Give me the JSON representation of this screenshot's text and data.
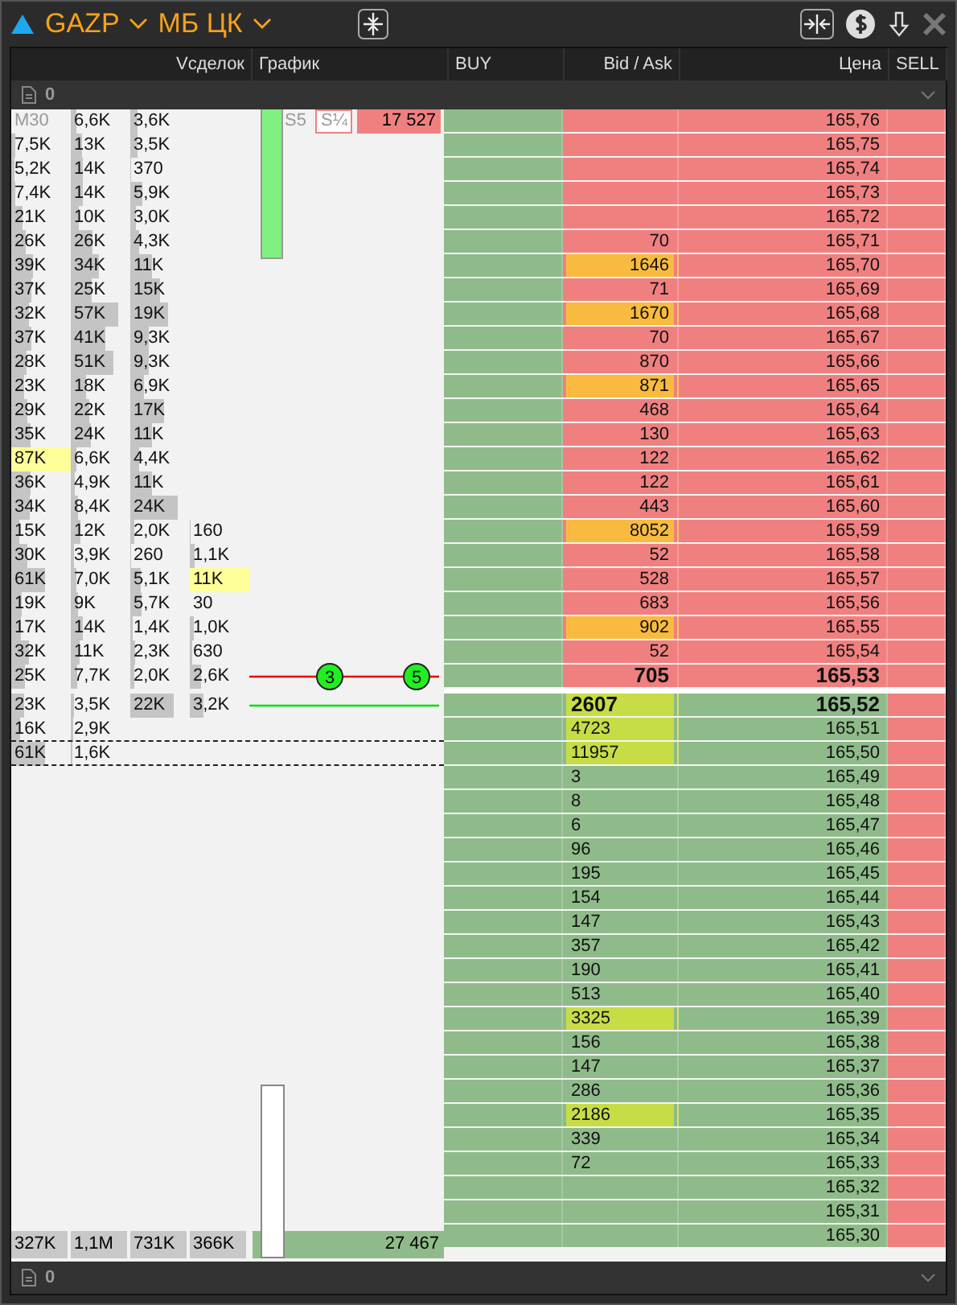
{
  "title": {
    "symbol": "GAZP",
    "board": "МБ ЦК"
  },
  "columns": {
    "volume": "Vсделок",
    "chart": "График",
    "buy": "BUY",
    "bid_ask": "Bid / Ask",
    "price": "Цена",
    "sell": "SELL"
  },
  "orders_bar": {
    "count": "0"
  },
  "left_rows": [
    {
      "cells": [
        {
          "kind": "label",
          "text": "M30"
        },
        {
          "kind": "volume",
          "text": "6,6K",
          "highlight": false
        },
        {
          "kind": "volume",
          "text": "3,6K",
          "highlight": false
        }
      ],
      "chart": {
        "kind": "labels",
        "tag": "S5",
        "scale": "S¼",
        "value": "17 527"
      }
    },
    {
      "cells": [
        {
          "kind": "volume",
          "text": "7,5K",
          "highlight": false
        },
        {
          "kind": "volume",
          "text": "13K",
          "highlight": false
        },
        {
          "kind": "volume",
          "text": "3,5K",
          "highlight": false
        }
      ]
    },
    {
      "cells": [
        {
          "kind": "volume",
          "text": "5,2K",
          "highlight": false
        },
        {
          "kind": "volume",
          "text": "14K",
          "highlight": false
        },
        {
          "kind": "volume",
          "text": "370",
          "highlight": false
        }
      ]
    },
    {
      "cells": [
        {
          "kind": "volume",
          "text": "7,4K",
          "highlight": false
        },
        {
          "kind": "volume",
          "text": "14K",
          "highlight": false
        },
        {
          "kind": "volume",
          "text": "5,9K",
          "highlight": false
        }
      ]
    },
    {
      "cells": [
        {
          "kind": "volume",
          "text": "21K",
          "highlight": false
        },
        {
          "kind": "volume",
          "text": "10K",
          "highlight": false
        },
        {
          "kind": "volume",
          "text": "3,0K",
          "highlight": false
        }
      ]
    },
    {
      "cells": [
        {
          "kind": "volume",
          "text": "26K",
          "highlight": false
        },
        {
          "kind": "volume",
          "text": "26K",
          "highlight": false
        },
        {
          "kind": "volume",
          "text": "4,3K",
          "highlight": false
        }
      ]
    },
    {
      "cells": [
        {
          "kind": "volume",
          "text": "39K",
          "highlight": false
        },
        {
          "kind": "volume",
          "text": "34K",
          "highlight": false
        },
        {
          "kind": "volume",
          "text": "11K",
          "highlight": false
        }
      ]
    },
    {
      "cells": [
        {
          "kind": "volume",
          "text": "37K",
          "highlight": false
        },
        {
          "kind": "volume",
          "text": "25K",
          "highlight": false
        },
        {
          "kind": "volume",
          "text": "15K",
          "highlight": false
        }
      ]
    },
    {
      "cells": [
        {
          "kind": "volume",
          "text": "32K",
          "highlight": false
        },
        {
          "kind": "volume",
          "text": "57K",
          "highlight": false
        },
        {
          "kind": "volume",
          "text": "19K",
          "highlight": false
        }
      ]
    },
    {
      "cells": [
        {
          "kind": "volume",
          "text": "37K",
          "highlight": false
        },
        {
          "kind": "volume",
          "text": "41K",
          "highlight": false
        },
        {
          "kind": "volume",
          "text": "9,3K",
          "highlight": false
        }
      ]
    },
    {
      "cells": [
        {
          "kind": "volume",
          "text": "28K",
          "highlight": false
        },
        {
          "kind": "volume",
          "text": "51K",
          "highlight": false
        },
        {
          "kind": "volume",
          "text": "9,3K",
          "highlight": false
        }
      ]
    },
    {
      "cells": [
        {
          "kind": "volume",
          "text": "23K",
          "highlight": false
        },
        {
          "kind": "volume",
          "text": "18K",
          "highlight": false
        },
        {
          "kind": "volume",
          "text": "6,9K",
          "highlight": false
        }
      ]
    },
    {
      "cells": [
        {
          "kind": "volume",
          "text": "29K",
          "highlight": false
        },
        {
          "kind": "volume",
          "text": "22K",
          "highlight": false
        },
        {
          "kind": "volume",
          "text": "17K",
          "highlight": false
        }
      ]
    },
    {
      "cells": [
        {
          "kind": "volume",
          "text": "35K",
          "highlight": false
        },
        {
          "kind": "volume",
          "text": "24K",
          "highlight": false
        },
        {
          "kind": "volume",
          "text": "11K",
          "highlight": false
        }
      ]
    },
    {
      "cells": [
        {
          "kind": "volume",
          "text": "87K",
          "highlight": true
        },
        {
          "kind": "volume",
          "text": "6,6K",
          "highlight": false
        },
        {
          "kind": "volume",
          "text": "4,4K",
          "highlight": false
        }
      ]
    },
    {
      "cells": [
        {
          "kind": "volume",
          "text": "36K",
          "highlight": false
        },
        {
          "kind": "volume",
          "text": "4,9K",
          "highlight": false
        },
        {
          "kind": "volume",
          "text": "11K",
          "highlight": false
        }
      ]
    },
    {
      "cells": [
        {
          "kind": "volume",
          "text": "34K",
          "highlight": false
        },
        {
          "kind": "volume",
          "text": "8,4K",
          "highlight": false
        },
        {
          "kind": "volume",
          "text": "24K",
          "highlight": false
        }
      ]
    },
    {
      "cells": [
        {
          "kind": "volume",
          "text": "15K",
          "highlight": false
        },
        {
          "kind": "volume",
          "text": "12K",
          "highlight": false
        },
        {
          "kind": "volume",
          "text": "2,0K",
          "highlight": false
        },
        {
          "kind": "volume",
          "text": "160",
          "highlight": false
        }
      ]
    },
    {
      "cells": [
        {
          "kind": "volume",
          "text": "30K",
          "highlight": false
        },
        {
          "kind": "volume",
          "text": "3,9K",
          "highlight": false
        },
        {
          "kind": "volume",
          "text": "260",
          "highlight": false
        },
        {
          "kind": "volume",
          "text": "1,1K",
          "highlight": false
        }
      ]
    },
    {
      "cells": [
        {
          "kind": "volume",
          "text": "61K",
          "highlight": false
        },
        {
          "kind": "volume",
          "text": "7,0K",
          "highlight": false
        },
        {
          "kind": "volume",
          "text": "5,1K",
          "highlight": false
        },
        {
          "kind": "volume",
          "text": "11K",
          "highlight": true
        }
      ]
    },
    {
      "cells": [
        {
          "kind": "volume",
          "text": "19K",
          "highlight": false
        },
        {
          "kind": "volume",
          "text": "9K",
          "highlight": false
        },
        {
          "kind": "volume",
          "text": "5,7K",
          "highlight": false
        },
        {
          "kind": "volume",
          "text": "30",
          "highlight": false
        }
      ]
    },
    {
      "cells": [
        {
          "kind": "volume",
          "text": "17K",
          "highlight": false
        },
        {
          "kind": "volume",
          "text": "14K",
          "highlight": false
        },
        {
          "kind": "volume",
          "text": "1,4K",
          "highlight": false
        },
        {
          "kind": "volume",
          "text": "1,0K",
          "highlight": false
        }
      ]
    },
    {
      "cells": [
        {
          "kind": "volume",
          "text": "32K",
          "highlight": false
        },
        {
          "kind": "volume",
          "text": "11K",
          "highlight": false
        },
        {
          "kind": "volume",
          "text": "2,3K",
          "highlight": false
        },
        {
          "kind": "volume",
          "text": "630",
          "highlight": false
        }
      ]
    },
    {
      "cells": [
        {
          "kind": "volume",
          "text": "25K",
          "highlight": false
        },
        {
          "kind": "volume",
          "text": "7,7K",
          "highlight": false
        },
        {
          "kind": "volume",
          "text": "2,0K",
          "highlight": false
        },
        {
          "kind": "volume",
          "text": "2,6K",
          "highlight": false
        }
      ],
      "chart": {
        "kind": "ask_line",
        "markers": [
          "3",
          "5"
        ]
      }
    },
    {
      "cells": [
        {
          "kind": "volume",
          "text": "23K",
          "highlight": false
        },
        {
          "kind": "volume",
          "text": "3,5K",
          "highlight": false
        },
        {
          "kind": "volume",
          "text": "22K",
          "highlight": false
        },
        {
          "kind": "volume",
          "text": "3,2K",
          "highlight": false
        }
      ],
      "chart": {
        "kind": "bid_line"
      }
    },
    {
      "separator": true,
      "cells": [
        {
          "kind": "volume",
          "text": "16K",
          "highlight": false
        },
        {
          "kind": "volume",
          "text": "2,9K",
          "highlight": false
        }
      ]
    },
    {
      "separator": true,
      "cells": [
        {
          "kind": "volume",
          "text": "61K",
          "highlight": false
        },
        {
          "kind": "volume",
          "text": "1,6K",
          "highlight": false
        }
      ]
    }
  ],
  "totals": [
    "327K",
    "1,1M",
    "731K",
    "366K"
  ],
  "chart_total": "27 467",
  "ladder": [
    {
      "price": "165,76",
      "kind": "ask",
      "best": false
    },
    {
      "price": "165,75",
      "kind": "ask",
      "best": false
    },
    {
      "price": "165,74",
      "kind": "ask",
      "best": false
    },
    {
      "price": "165,73",
      "kind": "ask",
      "best": false
    },
    {
      "price": "165,72",
      "kind": "ask",
      "best": false
    },
    {
      "price": "165,71",
      "kind": "ask",
      "best": false,
      "volume": "70",
      "highlight": false
    },
    {
      "price": "165,70",
      "kind": "ask",
      "best": false,
      "volume": "1646",
      "highlight": true
    },
    {
      "price": "165,69",
      "kind": "ask",
      "best": false,
      "volume": "71",
      "highlight": false
    },
    {
      "price": "165,68",
      "kind": "ask",
      "best": false,
      "volume": "1670",
      "highlight": true
    },
    {
      "price": "165,67",
      "kind": "ask",
      "best": false,
      "volume": "70",
      "highlight": false
    },
    {
      "price": "165,66",
      "kind": "ask",
      "best": false,
      "volume": "870",
      "highlight": false
    },
    {
      "price": "165,65",
      "kind": "ask",
      "best": false,
      "volume": "871",
      "highlight": true
    },
    {
      "price": "165,64",
      "kind": "ask",
      "best": false,
      "volume": "468",
      "highlight": false
    },
    {
      "price": "165,63",
      "kind": "ask",
      "best": false,
      "volume": "130",
      "highlight": false
    },
    {
      "price": "165,62",
      "kind": "ask",
      "best": false,
      "volume": "122",
      "highlight": false
    },
    {
      "price": "165,61",
      "kind": "ask",
      "best": false,
      "volume": "122",
      "highlight": false
    },
    {
      "price": "165,60",
      "kind": "ask",
      "best": false,
      "volume": "443",
      "highlight": false
    },
    {
      "price": "165,59",
      "kind": "ask",
      "best": false,
      "volume": "8052",
      "highlight": true
    },
    {
      "price": "165,58",
      "kind": "ask",
      "best": false,
      "volume": "52",
      "highlight": false
    },
    {
      "price": "165,57",
      "kind": "ask",
      "best": false,
      "volume": "528",
      "highlight": false
    },
    {
      "price": "165,56",
      "kind": "ask",
      "best": false,
      "volume": "683",
      "highlight": false
    },
    {
      "price": "165,55",
      "kind": "ask",
      "best": false,
      "volume": "902",
      "highlight": true
    },
    {
      "price": "165,54",
      "kind": "ask",
      "best": false,
      "volume": "52",
      "highlight": false
    },
    {
      "price": "165,53",
      "kind": "ask",
      "best": true,
      "volume": "705",
      "highlight": false
    },
    {
      "price": "165,52",
      "kind": "bid",
      "best": true,
      "volume": "2607",
      "highlight": true
    },
    {
      "price": "165,51",
      "kind": "bid",
      "best": false,
      "volume": "4723",
      "highlight": true
    },
    {
      "price": "165,50",
      "kind": "bid",
      "best": false,
      "volume": "11957",
      "highlight": true
    },
    {
      "price": "165,49",
      "kind": "bid",
      "best": false,
      "volume": "3",
      "highlight": false
    },
    {
      "price": "165,48",
      "kind": "bid",
      "best": false,
      "volume": "8",
      "highlight": false
    },
    {
      "price": "165,47",
      "kind": "bid",
      "best": false,
      "volume": "6",
      "highlight": false
    },
    {
      "price": "165,46",
      "kind": "bid",
      "best": false,
      "volume": "96",
      "highlight": false
    },
    {
      "price": "165,45",
      "kind": "bid",
      "best": false,
      "volume": "195",
      "highlight": false
    },
    {
      "price": "165,44",
      "kind": "bid",
      "best": false,
      "volume": "154",
      "highlight": false
    },
    {
      "price": "165,43",
      "kind": "bid",
      "best": false,
      "volume": "147",
      "highlight": false
    },
    {
      "price": "165,42",
      "kind": "bid",
      "best": false,
      "volume": "357",
      "highlight": false
    },
    {
      "price": "165,41",
      "kind": "bid",
      "best": false,
      "volume": "190",
      "highlight": false
    },
    {
      "price": "165,40",
      "kind": "bid",
      "best": false,
      "volume": "513",
      "highlight": false
    },
    {
      "price": "165,39",
      "kind": "bid",
      "best": false,
      "volume": "3325",
      "highlight": true
    },
    {
      "price": "165,38",
      "kind": "bid",
      "best": false,
      "volume": "156",
      "highlight": false
    },
    {
      "price": "165,37",
      "kind": "bid",
      "best": false,
      "volume": "147",
      "highlight": false
    },
    {
      "price": "165,36",
      "kind": "bid",
      "best": false,
      "volume": "286",
      "highlight": false
    },
    {
      "price": "165,35",
      "kind": "bid",
      "best": false,
      "volume": "2186",
      "highlight": true
    },
    {
      "price": "165,34",
      "kind": "bid",
      "best": false,
      "volume": "339",
      "highlight": false
    },
    {
      "price": "165,33",
      "kind": "bid",
      "best": false,
      "volume": "72",
      "highlight": false
    },
    {
      "price": "165,32",
      "kind": "bid",
      "best": false
    },
    {
      "price": "165,31",
      "kind": "bid",
      "best": false
    },
    {
      "price": "165,30",
      "kind": "bid",
      "best": false
    }
  ],
  "bottom_bar": {
    "count": "0"
  }
}
